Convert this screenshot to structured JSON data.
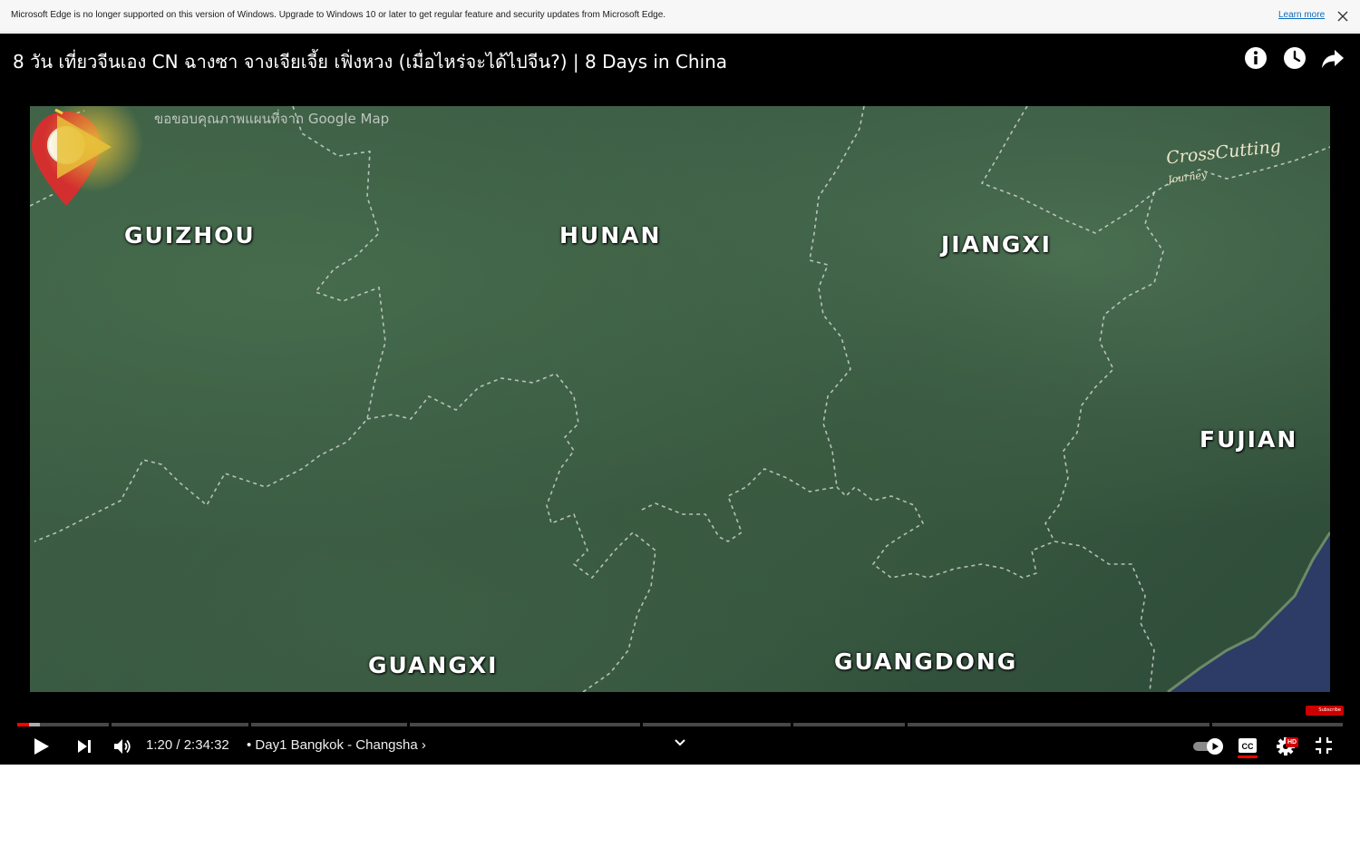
{
  "banner": {
    "message": "Microsoft Edge is no longer supported on this version of Windows. Upgrade to Windows 10 or later to get regular feature and security updates from Microsoft Edge.",
    "link": "Learn more"
  },
  "video": {
    "title": "8 วัน เที่ยวจีนเอง CN ฉางซา จางเจียเจี้ย เฟิ่งหวง (เมื่อไหร่จะได้ไปจีน?) | 8 Days in China",
    "map_credit": "ขอขอบคุณภาพแผนที่จาก Google Map",
    "provinces": {
      "guizhou": "GUIZHOU",
      "hunan": "HUNAN",
      "jiangxi": "JIANGXI",
      "fujian": "FUJIAN",
      "guangxi": "GUANGXI",
      "guangdong": "GUANGDONG"
    },
    "watermark": {
      "name": "CrossCutting",
      "sub": "Journey"
    },
    "subscribe_label": "Subscribe"
  },
  "controls": {
    "current_time": "1:20",
    "separator": "/",
    "duration": "2:34:32",
    "chapter": "• Day1 Bangkok - Changsha ›",
    "hd_badge": "HD",
    "progress_fraction": 0.0086,
    "buffer_fraction": 0.017
  },
  "icons": {
    "info": "info-icon",
    "watch_later": "clock-icon",
    "share": "share-icon",
    "play": "play-icon",
    "next": "next-icon",
    "volume": "volume-icon",
    "expand": "chevron-down-icon",
    "autoplay": "autoplay-toggle-icon",
    "captions": "cc-icon",
    "settings": "gear-icon",
    "exit_fullscreen": "exit-fullscreen-icon"
  },
  "colors": {
    "progress": "#ff0000",
    "pin": "#d32f2f",
    "edge_link": "#0f6cbd"
  }
}
